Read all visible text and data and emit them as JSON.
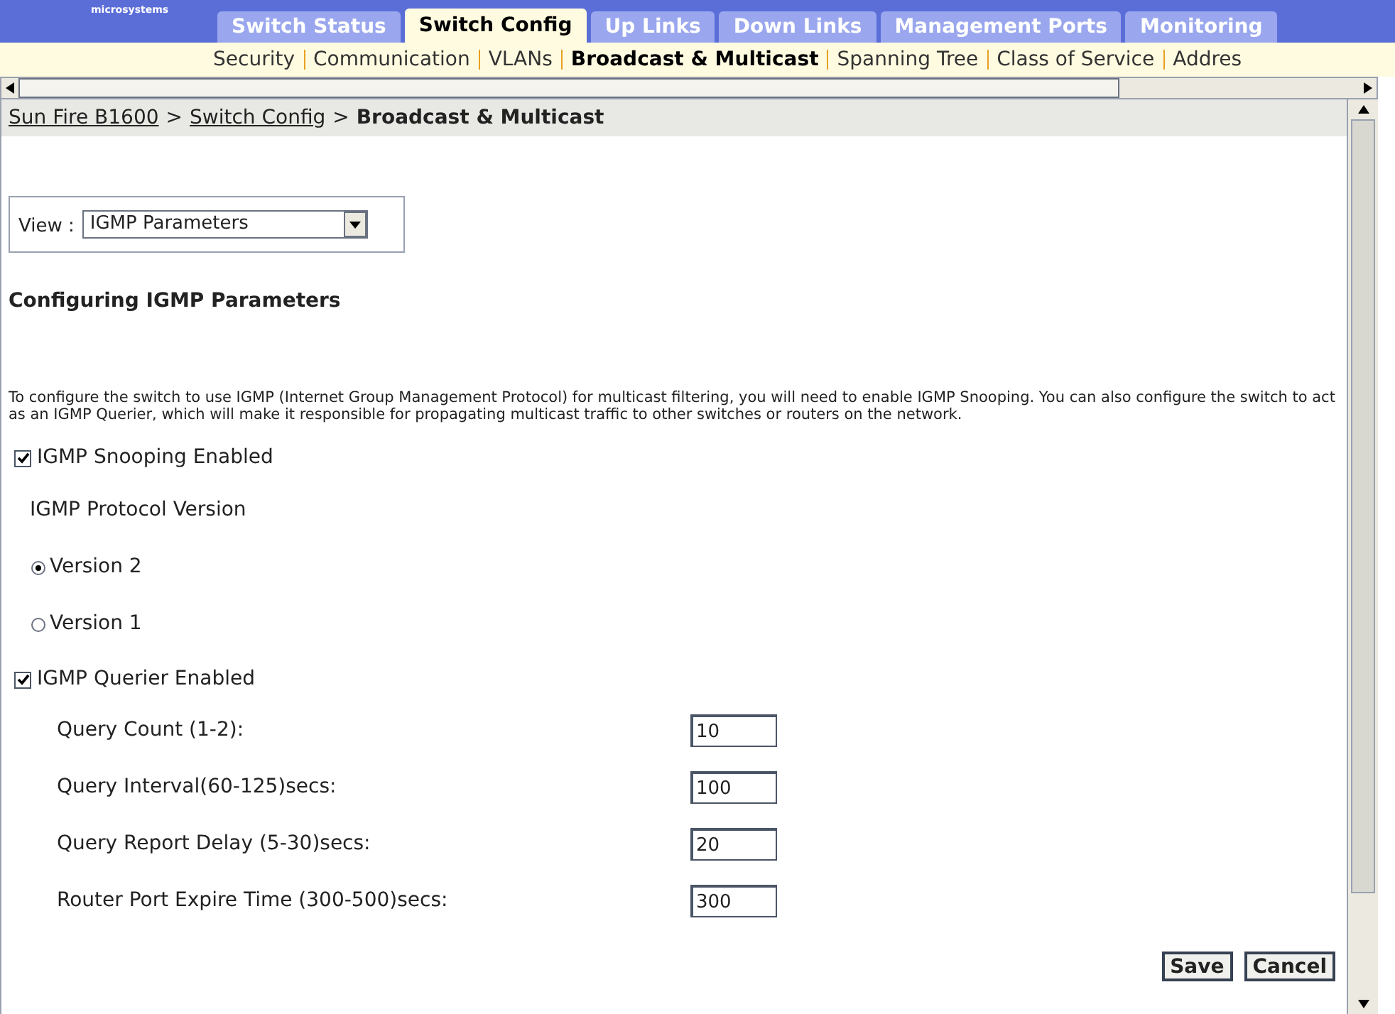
{
  "logo": {
    "text": "microsystems"
  },
  "tabs": [
    {
      "label": "Switch Status",
      "selected": false
    },
    {
      "label": "Switch Config",
      "selected": true
    },
    {
      "label": "Up Links",
      "selected": false
    },
    {
      "label": "Down Links",
      "selected": false
    },
    {
      "label": "Management Ports",
      "selected": false
    },
    {
      "label": "Monitoring",
      "selected": false
    }
  ],
  "subnav": [
    {
      "label": "Security",
      "selected": false
    },
    {
      "label": "Communication",
      "selected": false
    },
    {
      "label": "VLANs",
      "selected": false
    },
    {
      "label": "Broadcast & Multicast",
      "selected": true
    },
    {
      "label": "Spanning Tree",
      "selected": false
    },
    {
      "label": "Class of Service",
      "selected": false
    },
    {
      "label": "Addres",
      "selected": false
    }
  ],
  "breadcrumb": [
    {
      "label": "Sun Fire B1600",
      "kind": "link"
    },
    {
      "separator": ">",
      "label": "Switch Config",
      "kind": "link"
    },
    {
      "separator": ">",
      "label": "Broadcast & Multicast",
      "kind": "current"
    }
  ],
  "view": {
    "label": "View :",
    "value": "IGMP Parameters"
  },
  "heading": "Configuring IGMP Parameters",
  "description": "To configure the switch to use IGMP (Internet Group Management Protocol) for multicast filtering, you will need to enable IGMP Snooping. You can also configure the switch to act as an IGMP Querier, which will make it responsible for propagating multicast traffic to other switches or routers on the network.",
  "snooping": {
    "label": "IGMP Snooping Enabled",
    "checked": true
  },
  "protocol_label": "IGMP Protocol Version",
  "versions": [
    {
      "label": "Version 2",
      "selected": true
    },
    {
      "label": "Version 1",
      "selected": false
    }
  ],
  "querier": {
    "label": "IGMP Querier Enabled",
    "checked": true
  },
  "fields": [
    {
      "label": "Query Count (1-2):",
      "value": "10"
    },
    {
      "label": "Query Interval(60-125)secs:",
      "value": "100"
    },
    {
      "label": "Query Report Delay (5-30)secs:",
      "value": "20"
    },
    {
      "label": "Router Port Expire Time (300-500)secs:",
      "value": "300"
    }
  ],
  "buttons": [
    "Save",
    "Cancel"
  ]
}
